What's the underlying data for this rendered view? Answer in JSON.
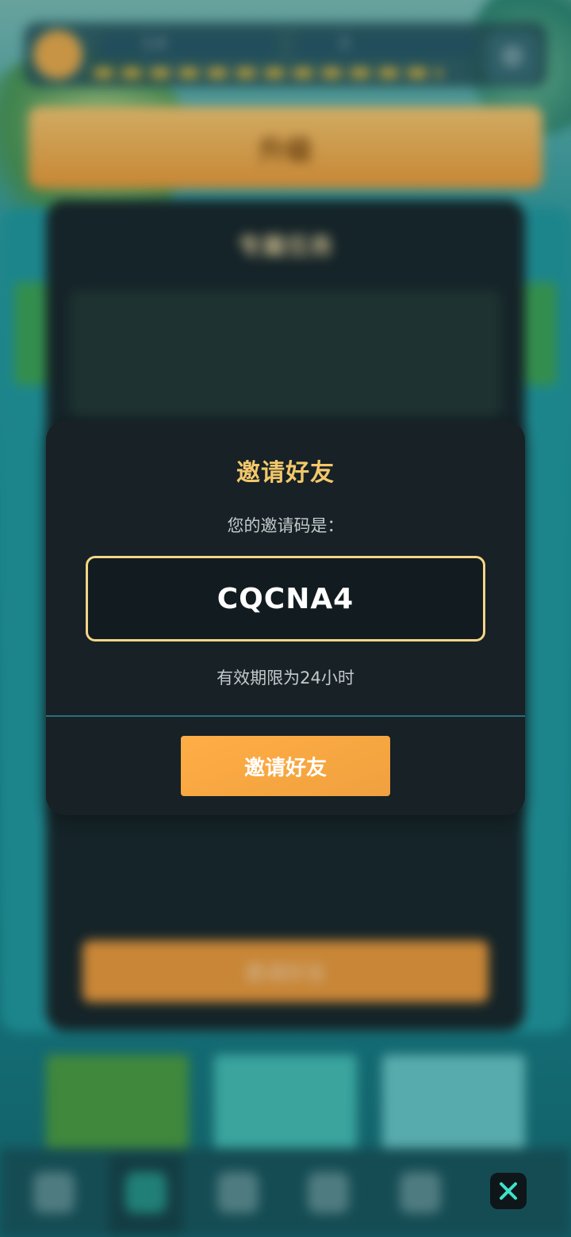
{
  "background": {
    "resource_1": "1.4",
    "resource_2": "3",
    "banner_label": "升级",
    "panel_title": "专属任务",
    "panel_description": "",
    "panel_button": "邀请好友"
  },
  "modal": {
    "title": "邀请好友",
    "code_label": "您的邀请码是：",
    "invite_code": "CQCNA4",
    "expiry_note": "有效期限为24小时",
    "invite_button_label": "邀请好友"
  },
  "colors": {
    "modal_bg": "#172126",
    "title_gold": "#f3c86b",
    "code_border": "#f4d587",
    "button_orange": "#f6a640",
    "divider_teal": "#2a6f7c"
  },
  "icons": {
    "close": "close-icon",
    "gear": "gear-icon"
  }
}
